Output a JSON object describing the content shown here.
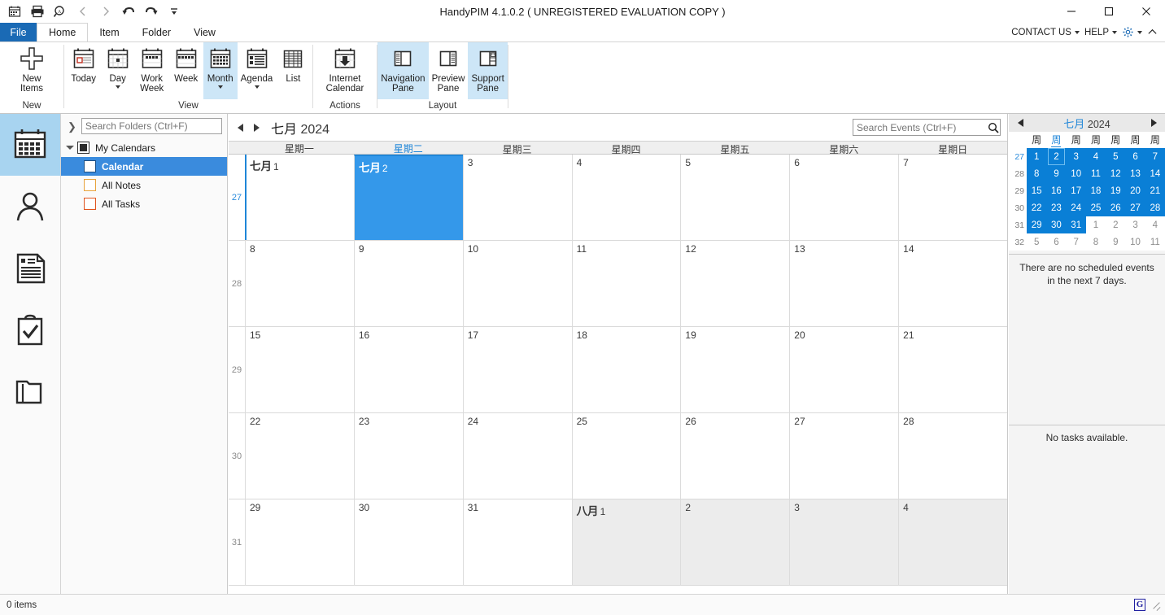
{
  "window": {
    "title": "HandyPIM 4.1.0.2 ( UNREGISTERED EVALUATION COPY )",
    "minimize": "—",
    "maximize": "□",
    "close": "✕"
  },
  "quick_access": [
    {
      "name": "calendar-icon",
      "label": "Calendar"
    },
    {
      "name": "print-icon",
      "label": "Print"
    },
    {
      "name": "print-preview-icon",
      "label": "Print Preview"
    },
    {
      "name": "back-icon",
      "label": "Back"
    },
    {
      "name": "forward-icon",
      "label": "Forward"
    },
    {
      "name": "undo-icon",
      "label": "Undo"
    },
    {
      "name": "redo-icon",
      "label": "Redo"
    },
    {
      "name": "customize-qat-icon",
      "label": "Customize Quick Access Toolbar"
    }
  ],
  "tabs": {
    "file": "File",
    "items": [
      "Home",
      "Item",
      "Folder",
      "View"
    ],
    "active": "Home"
  },
  "tabs_right": {
    "contact_us": "CONTACT US",
    "help": "HELP",
    "settings_icon": "gear-icon",
    "collapse_icon": "chevron-up-icon"
  },
  "ribbon": {
    "groups": [
      {
        "label": "New",
        "buttons": [
          {
            "label": "New\nItems",
            "icon": "plus-icon",
            "dropdown": true,
            "selected": false
          }
        ]
      },
      {
        "label": "View",
        "buttons": [
          {
            "label": "Today",
            "icon": "calendar-today-icon",
            "dropdown": false,
            "selected": false
          },
          {
            "label": "Day",
            "icon": "calendar-day-icon",
            "dropdown": true,
            "selected": false
          },
          {
            "label": "Work\nWeek",
            "icon": "calendar-workweek-icon",
            "dropdown": false,
            "selected": false
          },
          {
            "label": "Week",
            "icon": "calendar-week-icon",
            "dropdown": false,
            "selected": false
          },
          {
            "label": "Month",
            "icon": "calendar-month-icon",
            "dropdown": true,
            "selected": true
          },
          {
            "label": "Agenda",
            "icon": "calendar-agenda-icon",
            "dropdown": true,
            "selected": false
          },
          {
            "label": "List",
            "icon": "list-icon",
            "dropdown": false,
            "selected": false
          }
        ]
      },
      {
        "label": "Actions",
        "buttons": [
          {
            "label": "Internet\nCalendar",
            "icon": "internet-calendar-icon",
            "dropdown": true,
            "selected": false
          }
        ]
      },
      {
        "label": "Layout",
        "buttons": [
          {
            "label": "Navigation\nPane",
            "icon": "navigation-pane-icon",
            "dropdown": false,
            "selected": true
          },
          {
            "label": "Preview\nPane",
            "icon": "preview-pane-icon",
            "dropdown": true,
            "selected": false
          },
          {
            "label": "Support\nPane",
            "icon": "support-pane-icon",
            "dropdown": true,
            "selected": true
          }
        ]
      }
    ]
  },
  "navrail": [
    {
      "name": "nav-calendar",
      "icon": "calendar-icon",
      "active": true
    },
    {
      "name": "nav-contacts",
      "icon": "person-icon",
      "active": false
    },
    {
      "name": "nav-notes",
      "icon": "note-icon",
      "active": false
    },
    {
      "name": "nav-tasks",
      "icon": "clipboard-check-icon",
      "active": false
    },
    {
      "name": "nav-folders",
      "icon": "folder-icon",
      "active": false
    }
  ],
  "folder_pane": {
    "search_placeholder": "Search Folders (Ctrl+F)",
    "search_value": "",
    "tree": [
      {
        "label": "My Calendars",
        "level": 0,
        "checkbox": "filled",
        "selected": false
      },
      {
        "label": "Calendar",
        "level": 1,
        "checkbox": "checked",
        "selected": true
      },
      {
        "label": "All Notes",
        "level": 1,
        "checkbox": "orange",
        "selected": false
      },
      {
        "label": "All Tasks",
        "level": 1,
        "checkbox": "red",
        "selected": false
      }
    ]
  },
  "calendar": {
    "prev_label": "◀",
    "next_label": "▶",
    "month_label": "七月",
    "year_label": "2024",
    "search_placeholder": "Search Events (Ctrl+F)",
    "search_value": "",
    "search_icon": "magnifier-icon",
    "day_names": [
      "星期一",
      "星期二",
      "星期三",
      "星期四",
      "星期五",
      "星期六",
      "星期日"
    ],
    "highlight_day_index": 1,
    "week_numbers": [
      "27",
      "28",
      "29",
      "30",
      "31"
    ],
    "current_week_index": 0,
    "weeks": [
      [
        {
          "num": "1",
          "month_label": "七月",
          "other": false,
          "selected": false,
          "bold": true
        },
        {
          "num": "2",
          "month_label": "七月",
          "other": false,
          "selected": true,
          "bold": true
        },
        {
          "num": "3",
          "month_label": "",
          "other": false,
          "selected": false,
          "bold": false
        },
        {
          "num": "4",
          "month_label": "",
          "other": false,
          "selected": false,
          "bold": false
        },
        {
          "num": "5",
          "month_label": "",
          "other": false,
          "selected": false,
          "bold": false
        },
        {
          "num": "6",
          "month_label": "",
          "other": false,
          "selected": false,
          "bold": false
        },
        {
          "num": "7",
          "month_label": "",
          "other": false,
          "selected": false,
          "bold": false
        }
      ],
      [
        {
          "num": "8",
          "month_label": "",
          "other": false,
          "selected": false,
          "bold": false
        },
        {
          "num": "9",
          "month_label": "",
          "other": false,
          "selected": false,
          "bold": false
        },
        {
          "num": "10",
          "month_label": "",
          "other": false,
          "selected": false,
          "bold": false
        },
        {
          "num": "11",
          "month_label": "",
          "other": false,
          "selected": false,
          "bold": false
        },
        {
          "num": "12",
          "month_label": "",
          "other": false,
          "selected": false,
          "bold": false
        },
        {
          "num": "13",
          "month_label": "",
          "other": false,
          "selected": false,
          "bold": false
        },
        {
          "num": "14",
          "month_label": "",
          "other": false,
          "selected": false,
          "bold": false
        }
      ],
      [
        {
          "num": "15",
          "month_label": "",
          "other": false,
          "selected": false,
          "bold": false
        },
        {
          "num": "16",
          "month_label": "",
          "other": false,
          "selected": false,
          "bold": false
        },
        {
          "num": "17",
          "month_label": "",
          "other": false,
          "selected": false,
          "bold": false
        },
        {
          "num": "18",
          "month_label": "",
          "other": false,
          "selected": false,
          "bold": false
        },
        {
          "num": "19",
          "month_label": "",
          "other": false,
          "selected": false,
          "bold": false
        },
        {
          "num": "20",
          "month_label": "",
          "other": false,
          "selected": false,
          "bold": false
        },
        {
          "num": "21",
          "month_label": "",
          "other": false,
          "selected": false,
          "bold": false
        }
      ],
      [
        {
          "num": "22",
          "month_label": "",
          "other": false,
          "selected": false,
          "bold": false
        },
        {
          "num": "23",
          "month_label": "",
          "other": false,
          "selected": false,
          "bold": false
        },
        {
          "num": "24",
          "month_label": "",
          "other": false,
          "selected": false,
          "bold": false
        },
        {
          "num": "25",
          "month_label": "",
          "other": false,
          "selected": false,
          "bold": false
        },
        {
          "num": "26",
          "month_label": "",
          "other": false,
          "selected": false,
          "bold": false
        },
        {
          "num": "27",
          "month_label": "",
          "other": false,
          "selected": false,
          "bold": false
        },
        {
          "num": "28",
          "month_label": "",
          "other": false,
          "selected": false,
          "bold": false
        }
      ],
      [
        {
          "num": "29",
          "month_label": "",
          "other": false,
          "selected": false,
          "bold": false
        },
        {
          "num": "30",
          "month_label": "",
          "other": false,
          "selected": false,
          "bold": false
        },
        {
          "num": "31",
          "month_label": "",
          "other": false,
          "selected": false,
          "bold": false
        },
        {
          "num": "1",
          "month_label": "八月",
          "other": true,
          "selected": false,
          "bold": true
        },
        {
          "num": "2",
          "month_label": "",
          "other": true,
          "selected": false,
          "bold": false
        },
        {
          "num": "3",
          "month_label": "",
          "other": true,
          "selected": false,
          "bold": false
        },
        {
          "num": "4",
          "month_label": "",
          "other": true,
          "selected": false,
          "bold": false
        }
      ]
    ]
  },
  "support_pane": {
    "mini_prev": "◀",
    "mini_next": "▶",
    "mini_month": "七月",
    "mini_year": "2024",
    "mini_day_names": [
      "周",
      "周",
      "周",
      "周",
      "周",
      "周",
      "周"
    ],
    "mini_highlight_index": 1,
    "mini_week_numbers": [
      "27",
      "28",
      "29",
      "30",
      "31",
      "32"
    ],
    "mini_weeks": [
      [
        {
          "d": "1",
          "in": true,
          "today": false
        },
        {
          "d": "2",
          "in": true,
          "today": true
        },
        {
          "d": "3",
          "in": true,
          "today": false
        },
        {
          "d": "4",
          "in": true,
          "today": false
        },
        {
          "d": "5",
          "in": true,
          "today": false
        },
        {
          "d": "6",
          "in": true,
          "today": false
        },
        {
          "d": "7",
          "in": true,
          "today": false
        }
      ],
      [
        {
          "d": "8",
          "in": true,
          "today": false
        },
        {
          "d": "9",
          "in": true,
          "today": false
        },
        {
          "d": "10",
          "in": true,
          "today": false
        },
        {
          "d": "11",
          "in": true,
          "today": false
        },
        {
          "d": "12",
          "in": true,
          "today": false
        },
        {
          "d": "13",
          "in": true,
          "today": false
        },
        {
          "d": "14",
          "in": true,
          "today": false
        }
      ],
      [
        {
          "d": "15",
          "in": true,
          "today": false
        },
        {
          "d": "16",
          "in": true,
          "today": false
        },
        {
          "d": "17",
          "in": true,
          "today": false
        },
        {
          "d": "18",
          "in": true,
          "today": false
        },
        {
          "d": "19",
          "in": true,
          "today": false
        },
        {
          "d": "20",
          "in": true,
          "today": false
        },
        {
          "d": "21",
          "in": true,
          "today": false
        }
      ],
      [
        {
          "d": "22",
          "in": true,
          "today": false
        },
        {
          "d": "23",
          "in": true,
          "today": false
        },
        {
          "d": "24",
          "in": true,
          "today": false
        },
        {
          "d": "25",
          "in": true,
          "today": false
        },
        {
          "d": "26",
          "in": true,
          "today": false
        },
        {
          "d": "27",
          "in": true,
          "today": false
        },
        {
          "d": "28",
          "in": true,
          "today": false
        }
      ],
      [
        {
          "d": "29",
          "in": true,
          "today": false
        },
        {
          "d": "30",
          "in": true,
          "today": false
        },
        {
          "d": "31",
          "in": true,
          "today": false
        },
        {
          "d": "1",
          "in": false,
          "today": false
        },
        {
          "d": "2",
          "in": false,
          "today": false
        },
        {
          "d": "3",
          "in": false,
          "today": false
        },
        {
          "d": "4",
          "in": false,
          "today": false
        }
      ],
      [
        {
          "d": "5",
          "in": false,
          "today": false
        },
        {
          "d": "6",
          "in": false,
          "today": false
        },
        {
          "d": "7",
          "in": false,
          "today": false
        },
        {
          "d": "8",
          "in": false,
          "today": false
        },
        {
          "d": "9",
          "in": false,
          "today": false
        },
        {
          "d": "10",
          "in": false,
          "today": false
        },
        {
          "d": "11",
          "in": false,
          "today": false
        }
      ]
    ],
    "events_message": "There are no scheduled events in the next 7 days.",
    "tasks_message": "No tasks available."
  },
  "status_bar": {
    "items_text": "0 items",
    "right_icon": "g-logo-icon"
  },
  "colors": {
    "accent_blue": "#1a6ab5",
    "selection_blue": "#3498ea",
    "mini_blue": "#0a7fd6",
    "ribbon_selected": "#cde6f7"
  }
}
